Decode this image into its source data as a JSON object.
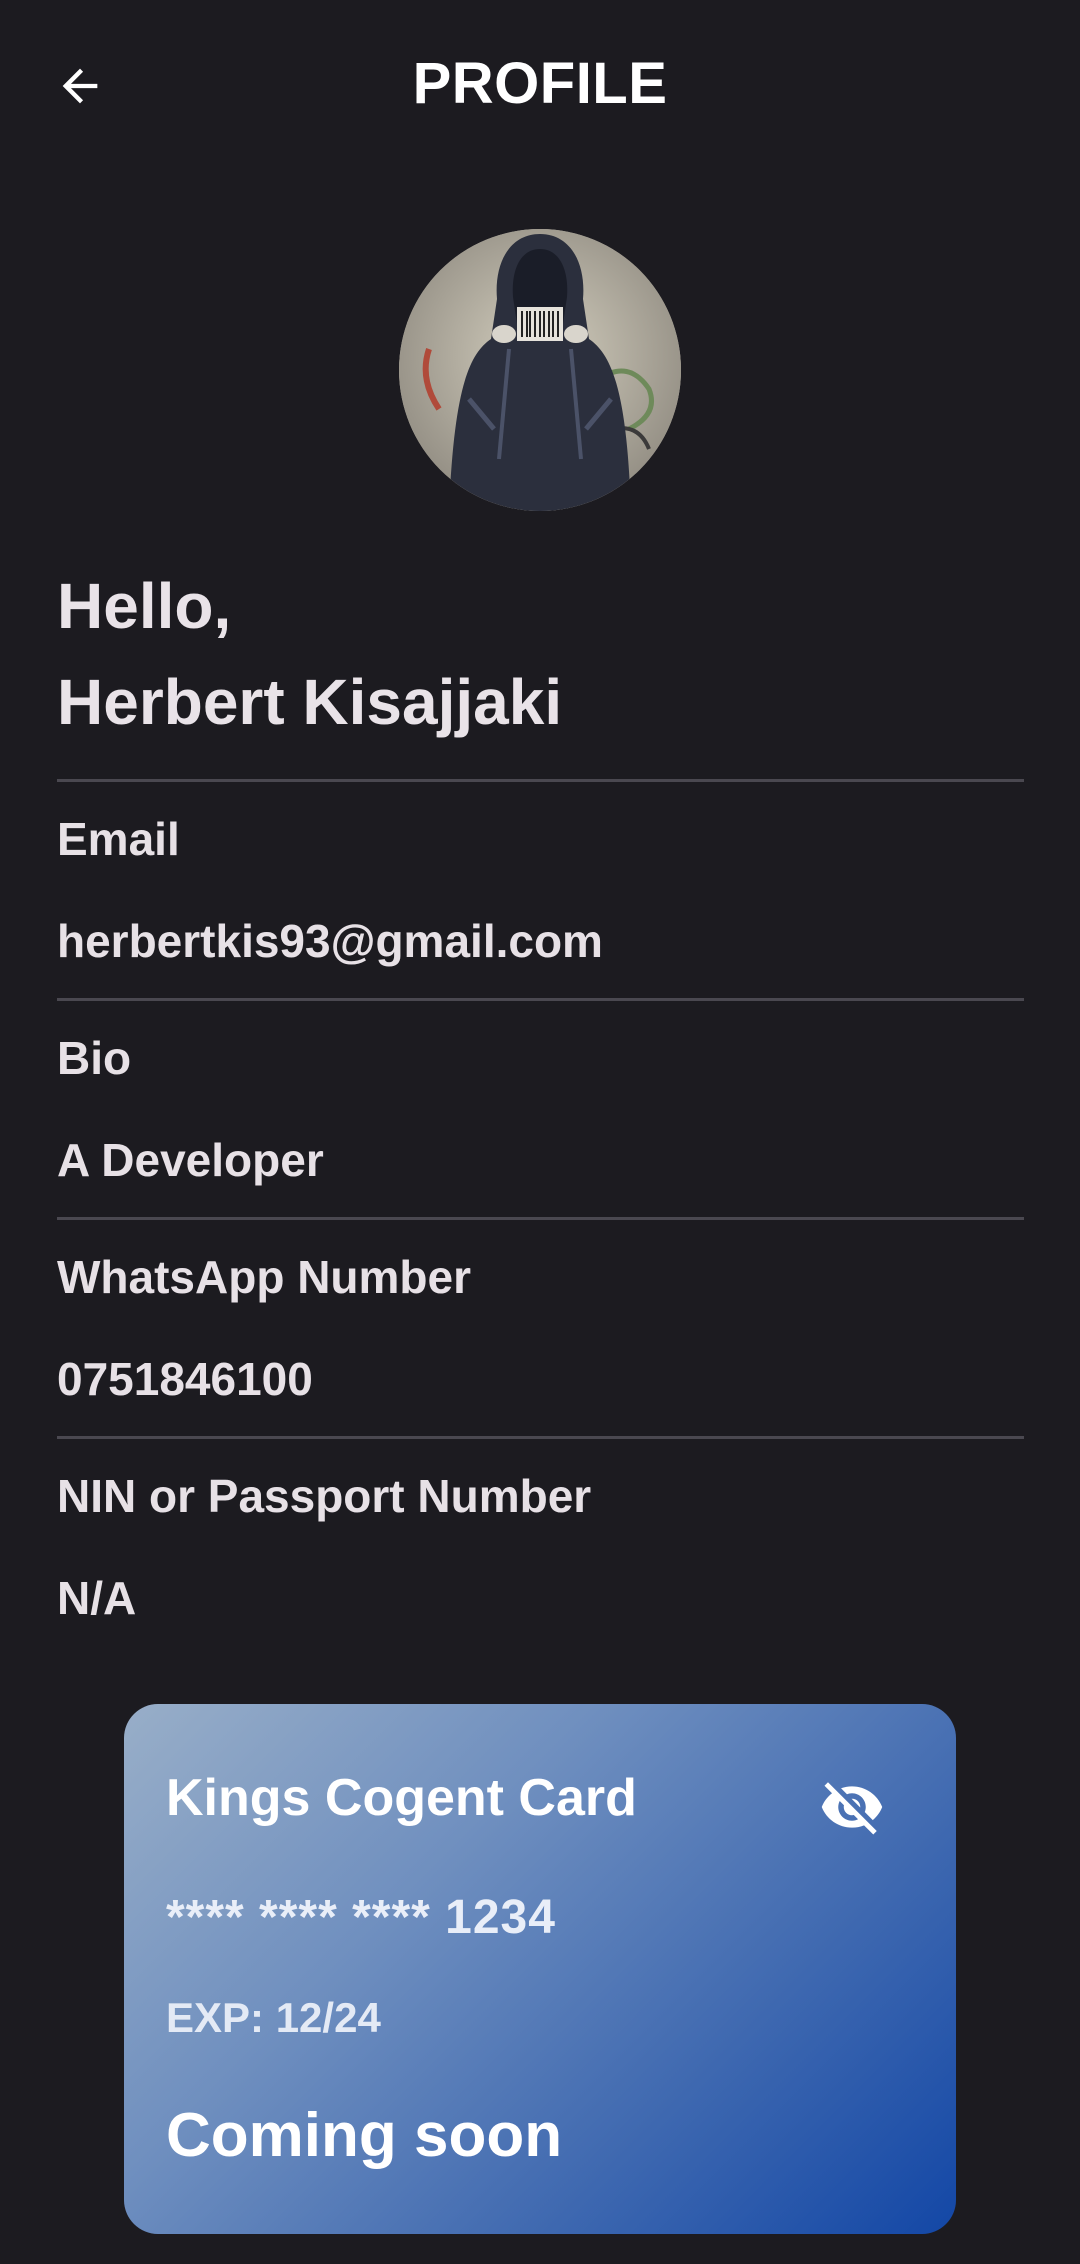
{
  "header": {
    "title": "PROFILE",
    "back_icon": "arrow-left-icon"
  },
  "profile": {
    "avatar_icon": "profile-photo",
    "greeting_line1": "Hello,",
    "name": "Herbert Kisajjaki"
  },
  "fields": [
    {
      "label": "Email",
      "value": "herbertkis93@gmail.com"
    },
    {
      "label": "Bio",
      "value": "A Developer"
    },
    {
      "label": "WhatsApp Number",
      "value": "0751846100"
    },
    {
      "label": "NIN or Passport Number",
      "value": "N/A"
    }
  ],
  "card": {
    "title": "Kings Cogent Card",
    "visibility_icon": "eye-off-icon",
    "number": "**** **** **** 1234",
    "expiry": "EXP: 12/24",
    "status": "Coming soon",
    "gradient_start": "#98aec8",
    "gradient_end": "#1347a6"
  },
  "colors": {
    "background": "#1c1b20",
    "text": "#e7e1e6",
    "divider": "#4a4850"
  }
}
